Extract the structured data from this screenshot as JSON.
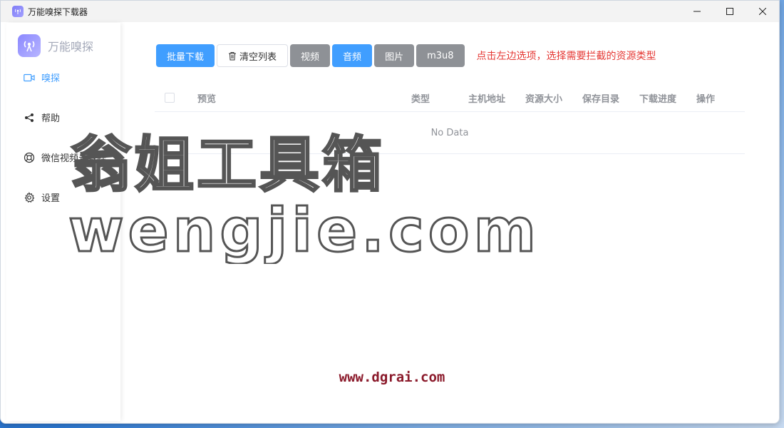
{
  "window": {
    "title": "万能嗅探下载器"
  },
  "sidebar": {
    "brand": "万能嗅探",
    "items": [
      {
        "label": "嗅探",
        "icon": "video-camera-icon"
      },
      {
        "label": "帮助",
        "icon": "share-icon"
      },
      {
        "label": "微信视频号教程",
        "icon": "lifebuoy-icon"
      },
      {
        "label": "设置",
        "icon": "gear-icon"
      }
    ]
  },
  "toolbar": {
    "batch_download": "批量下载",
    "clear_list": "清空列表",
    "filter_video": "视频",
    "filter_audio": "音频",
    "filter_image": "图片",
    "filter_m3u8": "m3u8",
    "hint": "点击左边选项，选择需要拦截的资源类型"
  },
  "table": {
    "columns": [
      "预览",
      "类型",
      "主机地址",
      "资源大小",
      "保存目录",
      "下载进度",
      "操作"
    ],
    "empty_text": "No Data"
  },
  "watermark": {
    "line1": "翁姐工具箱",
    "line2": "wengjie.com",
    "footer": "www.dgrai.com"
  },
  "colors": {
    "accent": "#409eff",
    "hint": "#e53935",
    "gray_button": "#8e9196"
  }
}
